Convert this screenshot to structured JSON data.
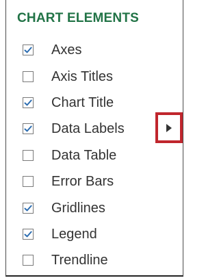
{
  "panel": {
    "title": "CHART ELEMENTS",
    "accent_color": "#217346",
    "check_color": "#2b6cb0",
    "items": [
      {
        "label": "Axes",
        "checked": true
      },
      {
        "label": "Axis Titles",
        "checked": false
      },
      {
        "label": "Chart Title",
        "checked": true
      },
      {
        "label": "Data Labels",
        "checked": true
      },
      {
        "label": "Data Table",
        "checked": false
      },
      {
        "label": "Error Bars",
        "checked": false
      },
      {
        "label": "Gridlines",
        "checked": true
      },
      {
        "label": "Legend",
        "checked": true
      },
      {
        "label": "Trendline",
        "checked": false
      }
    ],
    "flyout": {
      "icon": "caret-right-icon",
      "highlight_color": "#c0262d"
    }
  }
}
